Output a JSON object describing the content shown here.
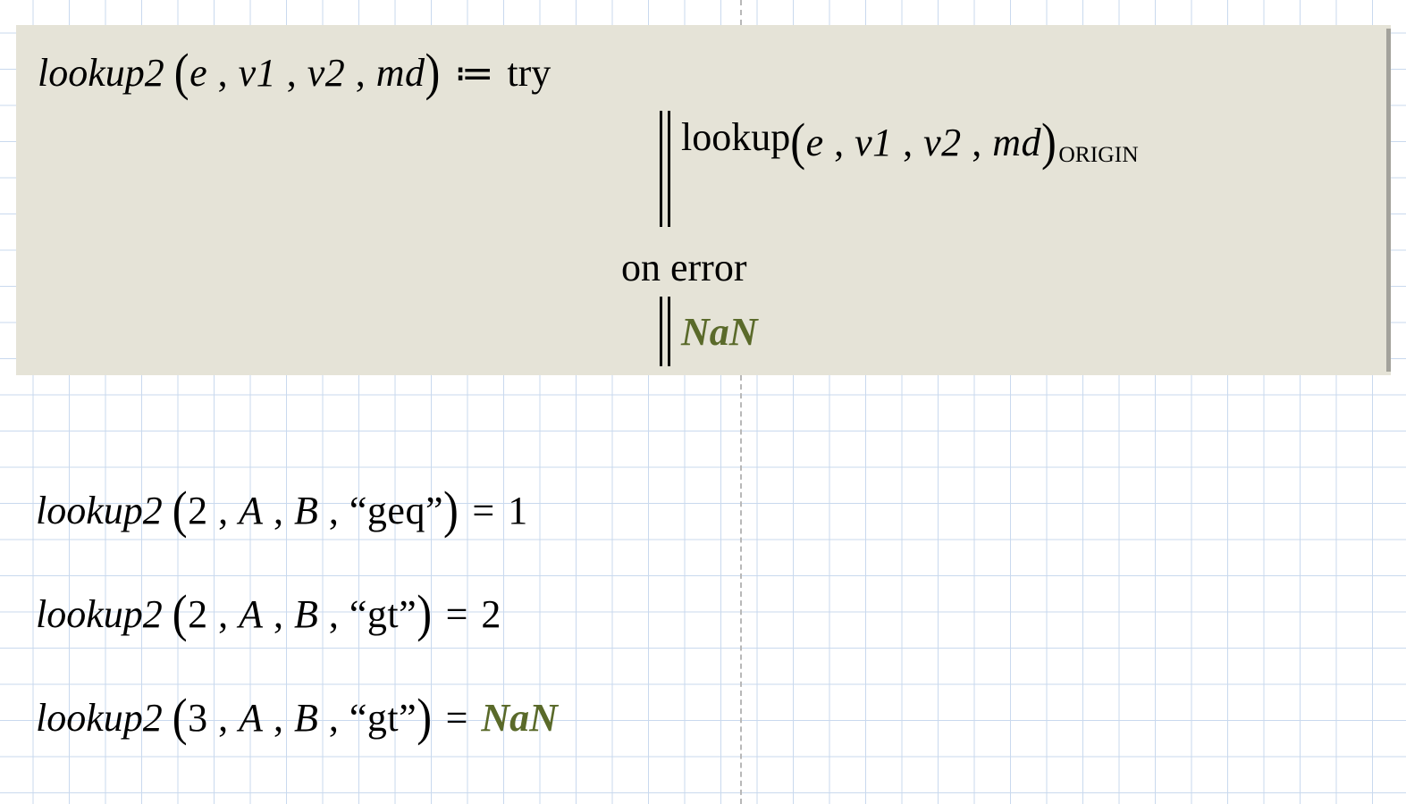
{
  "definition": {
    "fname": "lookup2",
    "params": [
      "e",
      "v1",
      "v2",
      "md"
    ],
    "assign_op": "≔",
    "try_kw": "try",
    "call_fname": "lookup",
    "call_args": [
      "e",
      "v1",
      "v2",
      "md"
    ],
    "subscript": "ORIGIN",
    "on_error_kw": "on error",
    "nan_label": "NaN"
  },
  "examples": [
    {
      "fname": "lookup2",
      "args": [
        "2",
        "A",
        "B",
        "\"geq\""
      ],
      "eq": "=",
      "result": "1"
    },
    {
      "fname": "lookup2",
      "args": [
        "2",
        "A",
        "B",
        "\"gt\""
      ],
      "eq": "=",
      "result": "2"
    },
    {
      "fname": "lookup2",
      "args": [
        "3",
        "A",
        "B",
        "\"gt\""
      ],
      "eq": "=",
      "result_nan": "NaN"
    }
  ]
}
